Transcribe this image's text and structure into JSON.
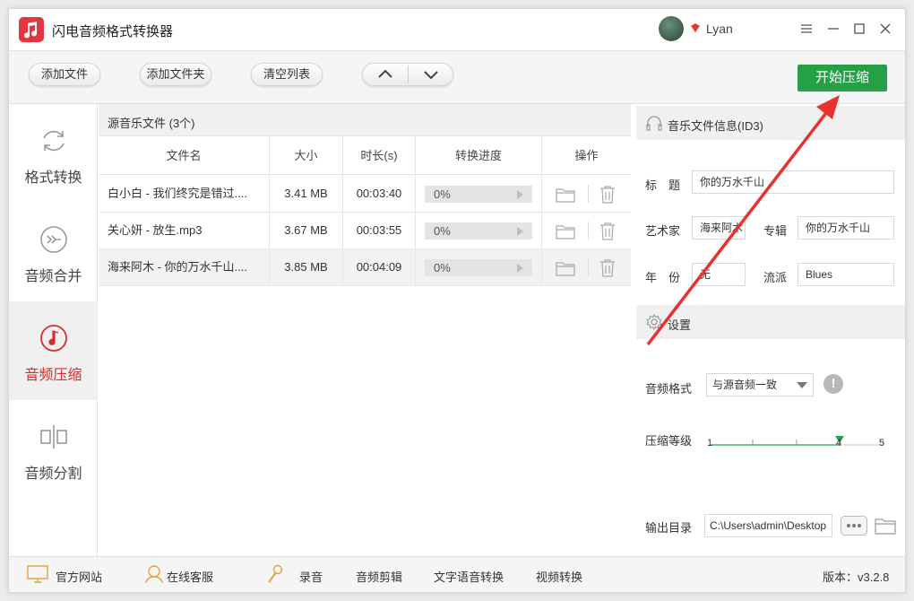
{
  "app": {
    "title": "闪电音频格式转换器"
  },
  "user": {
    "name": "Lyan"
  },
  "toolbar": {
    "add_file": "添加文件",
    "add_folder": "添加文件夹",
    "clear_list": "清空列表",
    "start": "开始压缩"
  },
  "sidebar": {
    "items": [
      {
        "label": "格式转换",
        "icon": "refresh-icon"
      },
      {
        "label": "音频合并",
        "icon": "merge-icon"
      },
      {
        "label": "音频压缩",
        "icon": "music-note-icon",
        "active": true
      },
      {
        "label": "音频分割",
        "icon": "split-icon"
      }
    ]
  },
  "filelist": {
    "header": "源音乐文件 (3个)",
    "columns": [
      "文件名",
      "大小",
      "时长(s)",
      "转换进度",
      "操作"
    ],
    "rows": [
      {
        "name": "白小白 - 我们终究是错过....",
        "size": "3.41 MB",
        "duration": "00:03:40",
        "progress": "0%"
      },
      {
        "name": "关心妍 - 放生.mp3",
        "size": "3.67 MB",
        "duration": "00:03:55",
        "progress": "0%"
      },
      {
        "name": "海来阿木 - 你的万水千山....",
        "size": "3.85 MB",
        "duration": "00:04:09",
        "progress": "0%"
      }
    ]
  },
  "id3": {
    "header": "音乐文件信息(ID3)",
    "title_label": "标　题",
    "title_value": "你的万水千山",
    "artist_label": "艺术家",
    "artist_value": "海来阿木",
    "album_label": "专辑",
    "album_value": "你的万水千山",
    "year_label": "年　份",
    "year_value": "无",
    "genre_label": "流派",
    "genre_value": "Blues"
  },
  "settings": {
    "header": "设置",
    "format_label": "音频格式",
    "format_value": "与源音频一致",
    "level_label": "压缩等级",
    "level_min": "1",
    "level_value": "4",
    "level_max": "5",
    "output_label": "输出目录",
    "output_value": "C:\\Users\\admin\\Desktop"
  },
  "bottom": {
    "website": "官方网站",
    "support": "在线客服",
    "record": "录音",
    "edit": "音频剪辑",
    "tts": "文字语音转换",
    "video": "视频转换",
    "version": "版本：v3.2.8"
  },
  "colors": {
    "accent_green": "#26a047",
    "active_red": "#d92c2c",
    "arrow_red": "#e8322f"
  }
}
